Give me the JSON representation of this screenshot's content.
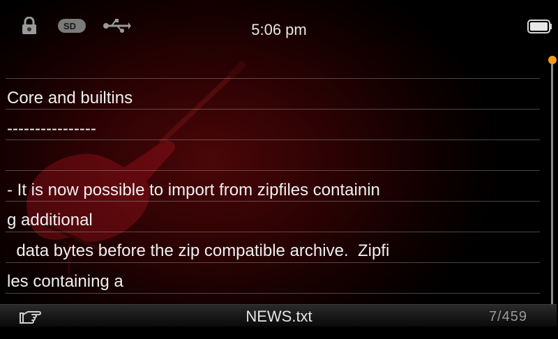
{
  "status_bar": {
    "time": "5:06 pm",
    "icons": [
      "lock-icon",
      "sd-card-icon",
      "usb-icon",
      "battery-icon"
    ],
    "sd_label": "SD"
  },
  "reader": {
    "lines": [
      "Core and builtins",
      "----------------",
      "",
      "- It is now possible to import from zipfiles containin",
      "g additional",
      "  data bytes before the zip compatible archive.  Zipfi",
      "les containing a"
    ]
  },
  "bottom_bar": {
    "filename": "NEWS.txt",
    "page_indicator": "7/459",
    "icon": "pointing-hand-icon"
  },
  "colors": {
    "accent": "#f39a1a",
    "background": "#2a0203",
    "text": "#f0f0f0"
  }
}
